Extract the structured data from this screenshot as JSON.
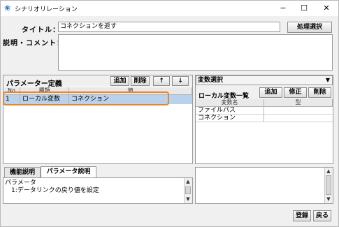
{
  "window": {
    "title": "シナリオリレーション",
    "minimize_glyph": "−",
    "maximize_glyph": "☐",
    "close_glyph": "✕"
  },
  "form": {
    "title_label": "タイトル：",
    "title_value": "コネクションを返す",
    "process_select_button": "処理選択",
    "comment_label": "説明・コメント：",
    "comment_value": ""
  },
  "param_panel": {
    "header": "パラメーター定義",
    "add_button": "追加",
    "delete_button": "削除",
    "up_button": "↑",
    "down_button": "↓",
    "columns": [
      "No",
      "種類",
      "値"
    ],
    "rows": [
      {
        "no": "1",
        "kind": "ローカル変数",
        "value": "コネクション"
      }
    ]
  },
  "var_panel": {
    "dropdown_value": "変数選択",
    "local_list_label": "ローカル変数一覧",
    "add_button": "追加",
    "edit_button": "修正",
    "delete_button": "削除",
    "columns": [
      "変数名",
      "型"
    ],
    "rows": [
      {
        "name": "ファイルパス",
        "type": ""
      },
      {
        "name": "コネクション",
        "type": ""
      }
    ]
  },
  "tabs": [
    {
      "label": "機能説明",
      "active": false
    },
    {
      "label": "パラメータ説明",
      "active": true
    }
  ],
  "description": {
    "line1": "パラメータ",
    "line2": "　1:データリンクの戻り値を設定"
  },
  "footer": {
    "register_button": "登録",
    "back_button": "戻る"
  },
  "colors": {
    "selected_row": "#b9d1ea",
    "highlight_outline": "#e8842c"
  }
}
